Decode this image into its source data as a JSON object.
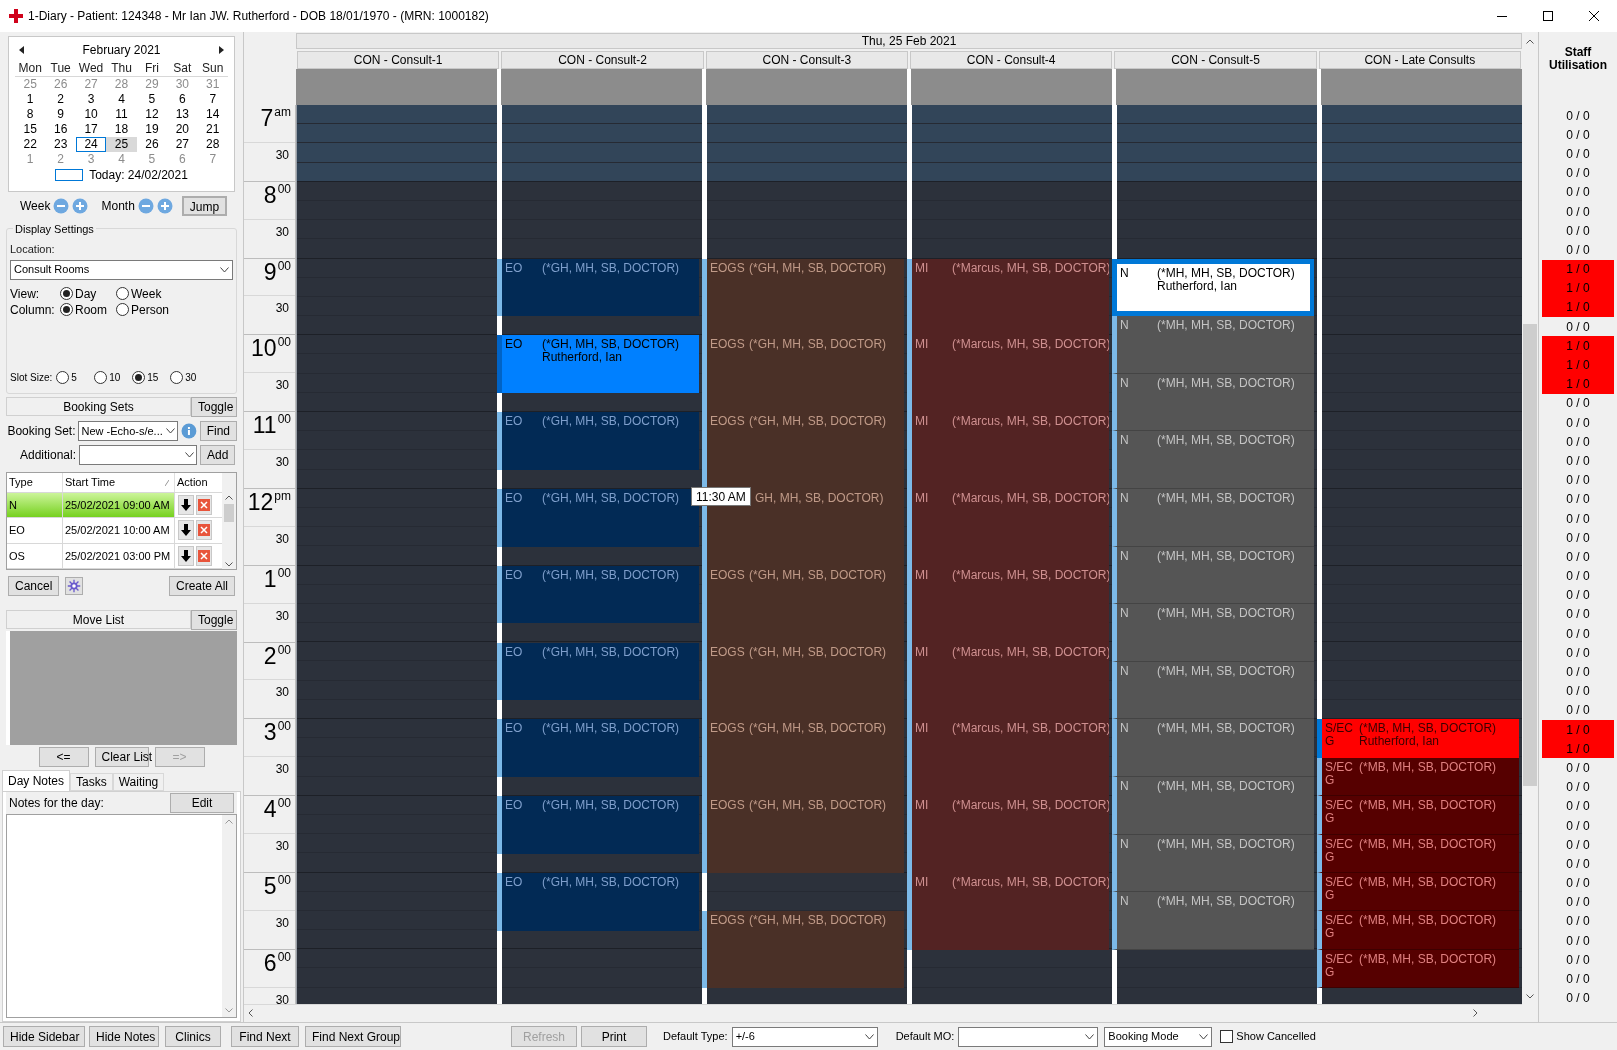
{
  "window": {
    "title": "1-Diary - Patient: 124348 - Mr Ian JW. Rutherford - DOB 18/01/1970 - (MRN: 1000182)"
  },
  "calendar": {
    "month": "February 2021",
    "weekdays": [
      "Mon",
      "Tue",
      "Wed",
      "Thu",
      "Fri",
      "Sat",
      "Sun"
    ],
    "weeks": [
      [
        {
          "d": "25",
          "muted": true,
          "today": false,
          "selected": false
        },
        {
          "d": "26",
          "muted": true,
          "today": false,
          "selected": false
        },
        {
          "d": "27",
          "muted": true,
          "today": false,
          "selected": false
        },
        {
          "d": "28",
          "muted": true,
          "today": false,
          "selected": false
        },
        {
          "d": "29",
          "muted": true,
          "today": false,
          "selected": false
        },
        {
          "d": "30",
          "muted": true,
          "today": false,
          "selected": false
        },
        {
          "d": "31",
          "muted": true,
          "today": false,
          "selected": false
        }
      ],
      [
        {
          "d": "1",
          "muted": false,
          "today": false,
          "selected": false
        },
        {
          "d": "2",
          "muted": false,
          "today": false,
          "selected": false
        },
        {
          "d": "3",
          "muted": false,
          "today": false,
          "selected": false
        },
        {
          "d": "4",
          "muted": false,
          "today": false,
          "selected": false
        },
        {
          "d": "5",
          "muted": false,
          "today": false,
          "selected": false
        },
        {
          "d": "6",
          "muted": false,
          "today": false,
          "selected": false
        },
        {
          "d": "7",
          "muted": false,
          "today": false,
          "selected": false
        }
      ],
      [
        {
          "d": "8",
          "muted": false,
          "today": false,
          "selected": false
        },
        {
          "d": "9",
          "muted": false,
          "today": false,
          "selected": false
        },
        {
          "d": "10",
          "muted": false,
          "today": false,
          "selected": false
        },
        {
          "d": "11",
          "muted": false,
          "today": false,
          "selected": false
        },
        {
          "d": "12",
          "muted": false,
          "today": false,
          "selected": false
        },
        {
          "d": "13",
          "muted": false,
          "today": false,
          "selected": false
        },
        {
          "d": "14",
          "muted": false,
          "today": false,
          "selected": false
        }
      ],
      [
        {
          "d": "15",
          "muted": false,
          "today": false,
          "selected": false
        },
        {
          "d": "16",
          "muted": false,
          "today": false,
          "selected": false
        },
        {
          "d": "17",
          "muted": false,
          "today": false,
          "selected": false
        },
        {
          "d": "18",
          "muted": false,
          "today": false,
          "selected": false
        },
        {
          "d": "19",
          "muted": false,
          "today": false,
          "selected": false
        },
        {
          "d": "20",
          "muted": false,
          "today": false,
          "selected": false
        },
        {
          "d": "21",
          "muted": false,
          "today": false,
          "selected": false
        }
      ],
      [
        {
          "d": "22",
          "muted": false,
          "today": false,
          "selected": false
        },
        {
          "d": "23",
          "muted": false,
          "today": false,
          "selected": false
        },
        {
          "d": "24",
          "muted": false,
          "today": true,
          "selected": false
        },
        {
          "d": "25",
          "muted": false,
          "today": false,
          "selected": true
        },
        {
          "d": "26",
          "muted": false,
          "today": false,
          "selected": false
        },
        {
          "d": "27",
          "muted": false,
          "today": false,
          "selected": false
        },
        {
          "d": "28",
          "muted": false,
          "today": false,
          "selected": false
        }
      ],
      [
        {
          "d": "1",
          "muted": true,
          "today": false,
          "selected": false
        },
        {
          "d": "2",
          "muted": true,
          "today": false,
          "selected": false
        },
        {
          "d": "3",
          "muted": true,
          "today": false,
          "selected": false
        },
        {
          "d": "4",
          "muted": true,
          "today": false,
          "selected": false
        },
        {
          "d": "5",
          "muted": true,
          "today": false,
          "selected": false
        },
        {
          "d": "6",
          "muted": true,
          "today": false,
          "selected": false
        },
        {
          "d": "7",
          "muted": true,
          "today": false,
          "selected": false
        }
      ]
    ],
    "today_label": "Today: 24/02/2021"
  },
  "nav": {
    "week": "Week",
    "month": "Month",
    "jump": "Jump"
  },
  "display_settings": {
    "title": "Display Settings",
    "location_label": "Location:",
    "location": "Consult Rooms",
    "view_label": "View:",
    "view_options": [
      {
        "label": "Day",
        "selected": true
      },
      {
        "label": "Week",
        "selected": false
      }
    ],
    "column_label": "Column:",
    "column_options": [
      {
        "label": "Room",
        "selected": true
      },
      {
        "label": "Person",
        "selected": false
      }
    ],
    "slot_label": "Slot Size:",
    "slot_options": [
      {
        "label": "5",
        "selected": false
      },
      {
        "label": "10",
        "selected": false
      },
      {
        "label": "15",
        "selected": true
      },
      {
        "label": "30",
        "selected": false
      }
    ]
  },
  "booking_sets": {
    "title": "Booking Sets",
    "toggle": "Toggle",
    "set_label": "Booking Set:",
    "set_value": "New -Echo-s/e...",
    "find": "Find",
    "additional_label": "Additional:",
    "add": "Add",
    "columns": [
      "Type",
      "Start Time",
      "Action"
    ],
    "rows": [
      {
        "type": "N",
        "start": "25/02/2021 09:00 AM",
        "selected": true
      },
      {
        "type": "EO",
        "start": "25/02/2021 10:00 AM",
        "selected": false
      },
      {
        "type": "OS",
        "start": "25/02/2021 03:00 PM",
        "selected": false
      }
    ],
    "cancel": "Cancel",
    "create_all": "Create All"
  },
  "move_list": {
    "title": "Move List",
    "toggle": "Toggle",
    "buttons": [
      {
        "label": "<=",
        "disabled": false
      },
      {
        "label": "Clear List",
        "disabled": false
      },
      {
        "label": "=>",
        "disabled": true
      }
    ]
  },
  "notes": {
    "tabs": [
      {
        "label": "Day Notes",
        "selected": true
      },
      {
        "label": "Tasks",
        "selected": false
      },
      {
        "label": "Waiting",
        "selected": false
      }
    ],
    "label": "Notes for the day:",
    "edit": "Edit"
  },
  "schedule": {
    "date": "Thu, 25 Feb 2021",
    "tooltip": "11:30 AM",
    "hours": [
      {
        "hour": "7",
        "suffix": "am",
        "half": "30"
      },
      {
        "hour": "8",
        "suffix": "00",
        "half": "30"
      },
      {
        "hour": "9",
        "suffix": "00",
        "half": "30"
      },
      {
        "hour": "10",
        "suffix": "00",
        "half": "30"
      },
      {
        "hour": "11",
        "suffix": "00",
        "half": "30"
      },
      {
        "hour": "12",
        "suffix": "pm",
        "half": "30"
      },
      {
        "hour": "1",
        "suffix": "00",
        "half": "30"
      },
      {
        "hour": "2",
        "suffix": "00",
        "half": "30"
      },
      {
        "hour": "3",
        "suffix": "00",
        "half": "30"
      },
      {
        "hour": "4",
        "suffix": "00",
        "half": "30"
      },
      {
        "hour": "5",
        "suffix": "00",
        "half": "30"
      },
      {
        "hour": "6",
        "suffix": "00",
        "half": "30"
      }
    ],
    "columns": [
      {
        "name": "CON - Consult-1",
        "kind": "eo"
      },
      {
        "name": "CON - Consult-2",
        "kind": "eo",
        "entries": [
          {
            "kind": "free_hour"
          },
          {
            "kind": "free_hour"
          },
          {
            "kind": "appointment",
            "code": "EO",
            "staff": "(*GH, MH, SB, DOCTOR)",
            "booked": false
          },
          {
            "kind": "free_quarter"
          },
          {
            "kind": "appointment",
            "code": "EO",
            "staff": "(*GH, MH, SB, DOCTOR)",
            "patient": "Rutherford, Ian",
            "booked": true
          },
          {
            "kind": "free_quarter"
          },
          {
            "kind": "appointment",
            "code": "EO",
            "staff": "(*GH, MH, SB, DOCTOR)",
            "booked": false
          },
          {
            "kind": "free_quarter"
          },
          {
            "kind": "appointment",
            "code": "EO",
            "staff": "(*GH, MH, SB, DOCTOR)",
            "booked": false
          },
          {
            "kind": "free_quarter"
          },
          {
            "kind": "appointment",
            "code": "EO",
            "staff": "(*GH, MH, SB, DOCTOR)",
            "booked": false
          },
          {
            "kind": "free_quarter"
          },
          {
            "kind": "appointment",
            "code": "EO",
            "staff": "(*GH, MH, SB, DOCTOR)",
            "booked": false
          },
          {
            "kind": "free_quarter"
          },
          {
            "kind": "appointment",
            "code": "EO",
            "staff": "(*GH, MH, SB, DOCTOR)",
            "booked": false
          },
          {
            "kind": "free_quarter"
          },
          {
            "kind": "appointment",
            "code": "EO",
            "staff": "(*GH, MH, SB, DOCTOR)",
            "booked": false
          },
          {
            "kind": "free_quarter"
          },
          {
            "kind": "appointment",
            "code": "EO",
            "staff": "(*GH, MH, SB, DOCTOR)",
            "booked": false
          }
        ]
      },
      {
        "name": "CON - Consult-3",
        "kind": "eogs",
        "entries": [
          {
            "kind": "free_hour"
          },
          {
            "kind": "free_hour"
          },
          {
            "kind": "appointment",
            "code": "EOGS",
            "staff": "(*GH, MH, SB, DOCTOR)",
            "booked": false
          },
          {
            "kind": "appointment",
            "code": "EOGS",
            "staff": "(*GH, MH, SB, DOCTOR)",
            "booked": false
          },
          {
            "kind": "appointment",
            "code": "EOGS",
            "staff": "(*GH, MH, SB, DOCTOR)",
            "booked": false
          },
          {
            "kind": "appointment",
            "staff": "GH, MH, SB, DOCTOR)",
            "booked": false
          },
          {
            "kind": "appointment",
            "code": "EOGS",
            "staff": "(*GH, MH, SB, DOCTOR)",
            "booked": false
          },
          {
            "kind": "appointment",
            "code": "EOGS",
            "staff": "(*GH, MH, SB, DOCTOR)",
            "booked": false
          },
          {
            "kind": "appointment",
            "code": "EOGS",
            "staff": "(*GH, MH, SB, DOCTOR)",
            "booked": false
          },
          {
            "kind": "appointment",
            "code": "EOGS",
            "staff": "(*GH, MH, SB, DOCTOR)",
            "booked": false
          },
          {
            "kind": "free_quarter"
          },
          {
            "kind": "free_quarter"
          },
          {
            "kind": "appointment",
            "code": "EOGS",
            "staff": "(*GH, MH, SB, DOCTOR)",
            "booked": false
          }
        ]
      },
      {
        "name": "CON - Consult-4",
        "kind": "mi",
        "entries": [
          {
            "kind": "free_hour"
          },
          {
            "kind": "free_hour"
          },
          {
            "kind": "appointment",
            "code": "MI",
            "staff": "(*Marcus, MH, SB, DOCTOR)",
            "booked": false
          },
          {
            "kind": "appointment",
            "code": "MI",
            "staff": "(*Marcus, MH, SB, DOCTOR)",
            "booked": false
          },
          {
            "kind": "appointment",
            "code": "MI",
            "staff": "(*Marcus, MH, SB, DOCTOR)",
            "booked": false
          },
          {
            "kind": "appointment",
            "code": "MI",
            "staff": "(*Marcus, MH, SB, DOCTOR)",
            "booked": false
          },
          {
            "kind": "appointment",
            "code": "MI",
            "staff": "(*Marcus, MH, SB, DOCTOR)",
            "booked": false
          },
          {
            "kind": "appointment",
            "code": "MI",
            "staff": "(*Marcus, MH, SB, DOCTOR)",
            "booked": false
          },
          {
            "kind": "appointment",
            "code": "MI",
            "staff": "(*Marcus, MH, SB, DOCTOR)",
            "booked": false
          },
          {
            "kind": "appointment",
            "code": "MI",
            "staff": "(*Marcus, MH, SB, DOCTOR)",
            "booked": false
          },
          {
            "kind": "appointment",
            "code": "MI",
            "staff": "(*Marcus, MH, SB, DOCTOR)",
            "booked": false
          }
        ]
      },
      {
        "name": "CON - Consult-5",
        "kind": "n",
        "entries": [
          {
            "kind": "free_hour"
          },
          {
            "kind": "free_hour"
          },
          {
            "kind": "appointment",
            "code": "N",
            "staff": "(*MH, MH, SB, DOCTOR)",
            "patient": "Rutherford, Ian",
            "booked": true
          },
          {
            "kind": "appointment",
            "code": "N",
            "staff": "(*MH, MH, SB, DOCTOR)",
            "booked": false
          },
          {
            "kind": "appointment",
            "code": "N",
            "staff": "(*MH, MH, SB, DOCTOR)",
            "booked": false
          },
          {
            "kind": "appointment",
            "code": "N",
            "staff": "(*MH, MH, SB, DOCTOR)",
            "booked": false
          },
          {
            "kind": "appointment",
            "code": "N",
            "staff": "(*MH, MH, SB, DOCTOR)",
            "booked": false
          },
          {
            "kind": "appointment",
            "code": "N",
            "staff": "(*MH, MH, SB, DOCTOR)",
            "booked": false
          },
          {
            "kind": "appointment",
            "code": "N",
            "staff": "(*MH, MH, SB, DOCTOR)",
            "booked": false
          },
          {
            "kind": "appointment",
            "code": "N",
            "staff": "(*MH, MH, SB, DOCTOR)",
            "booked": false
          },
          {
            "kind": "appointment",
            "code": "N",
            "staff": "(*MH, MH, SB, DOCTOR)",
            "booked": false
          },
          {
            "kind": "appointment",
            "code": "N",
            "staff": "(*MH, MH, SB, DOCTOR)",
            "booked": false
          },
          {
            "kind": "appointment",
            "code": "N",
            "staff": "(*MH, MH, SB, DOCTOR)",
            "booked": false
          },
          {
            "kind": "appointment",
            "code": "N",
            "staff": "(*MH, MH, SB, DOCTOR)",
            "booked": false
          }
        ]
      },
      {
        "name": "CON - Late Consults",
        "kind": "secg",
        "entries": [
          {
            "kind": "free_hour"
          },
          {
            "kind": "free_hour"
          },
          {
            "kind": "free_hour"
          },
          {
            "kind": "free_hour"
          },
          {
            "kind": "free_hour"
          },
          {
            "kind": "free_hour"
          },
          {
            "kind": "free_hour"
          },
          {
            "kind": "free_hour"
          },
          {
            "kind": "appointment",
            "code": "S/ECG",
            "staff": "(*MB, MH, SB, DOCTOR)",
            "patient": "Rutherford, Ian",
            "booked": true
          },
          {
            "kind": "appointment",
            "code": "S/ECG",
            "staff": "(*MB, MH, SB, DOCTOR)",
            "booked": false
          },
          {
            "kind": "appointment",
            "code": "S/ECG",
            "staff": "(*MB, MH, SB, DOCTOR)",
            "booked": false
          },
          {
            "kind": "appointment",
            "code": "S/ECG",
            "staff": "(*MB, MH, SB, DOCTOR)",
            "booked": false
          },
          {
            "kind": "appointment",
            "code": "S/ECG",
            "staff": "(*MB, MH, SB, DOCTOR)",
            "booked": false
          },
          {
            "kind": "appointment",
            "code": "S/ECG",
            "staff": "(*MB, MH, SB, DOCTOR)",
            "booked": false
          },
          {
            "kind": "appointment",
            "code": "S/ECG",
            "staff": "(*MB, MH, SB, DOCTOR)",
            "booked": false
          }
        ]
      }
    ]
  },
  "utilisation": {
    "title": "Staff Utilisation",
    "rows": [
      {
        "value": "0 / 0",
        "over": false
      },
      {
        "value": "0 / 0",
        "over": false
      },
      {
        "value": "0 / 0",
        "over": false
      },
      {
        "value": "0 / 0",
        "over": false
      },
      {
        "value": "0 / 0",
        "over": false
      },
      {
        "value": "0 / 0",
        "over": false
      },
      {
        "value": "0 / 0",
        "over": false
      },
      {
        "value": "0 / 0",
        "over": false
      },
      {
        "value": "1 / 0",
        "over": true
      },
      {
        "value": "1 / 0",
        "over": true
      },
      {
        "value": "1 / 0",
        "over": true
      },
      {
        "value": "0 / 0",
        "over": false
      },
      {
        "value": "1 / 0",
        "over": true
      },
      {
        "value": "1 / 0",
        "over": true
      },
      {
        "value": "1 / 0",
        "over": true
      },
      {
        "value": "0 / 0",
        "over": false
      },
      {
        "value": "0 / 0",
        "over": false
      },
      {
        "value": "0 / 0",
        "over": false
      },
      {
        "value": "0 / 0",
        "over": false
      },
      {
        "value": "0 / 0",
        "over": false
      },
      {
        "value": "0 / 0",
        "over": false
      },
      {
        "value": "0 / 0",
        "over": false
      },
      {
        "value": "0 / 0",
        "over": false
      },
      {
        "value": "0 / 0",
        "over": false
      },
      {
        "value": "0 / 0",
        "over": false
      },
      {
        "value": "0 / 0",
        "over": false
      },
      {
        "value": "0 / 0",
        "over": false
      },
      {
        "value": "0 / 0",
        "over": false
      },
      {
        "value": "0 / 0",
        "over": false
      },
      {
        "value": "0 / 0",
        "over": false
      },
      {
        "value": "0 / 0",
        "over": false
      },
      {
        "value": "0 / 0",
        "over": false
      },
      {
        "value": "1 / 0",
        "over": true
      },
      {
        "value": "1 / 0",
        "over": true
      },
      {
        "value": "0 / 0",
        "over": false
      },
      {
        "value": "0 / 0",
        "over": false
      },
      {
        "value": "0 / 0",
        "over": false
      },
      {
        "value": "0 / 0",
        "over": false
      },
      {
        "value": "0 / 0",
        "over": false
      },
      {
        "value": "0 / 0",
        "over": false
      },
      {
        "value": "0 / 0",
        "over": false
      },
      {
        "value": "0 / 0",
        "over": false
      },
      {
        "value": "0 / 0",
        "over": false
      },
      {
        "value": "0 / 0",
        "over": false
      },
      {
        "value": "0 / 0",
        "over": false
      },
      {
        "value": "0 / 0",
        "over": false
      },
      {
        "value": "0 / 0",
        "over": false
      }
    ]
  },
  "toolbar": {
    "buttons": [
      {
        "label": "Hide Sidebar",
        "disabled": false
      },
      {
        "label": "Hide Notes",
        "disabled": false
      },
      {
        "label": "Clinics",
        "disabled": false
      },
      {
        "label": "Find Next",
        "disabled": false
      },
      {
        "label": "Find Next Group",
        "disabled": false
      },
      {
        "label": "Refresh",
        "disabled": true
      },
      {
        "label": "Print",
        "disabled": false
      }
    ],
    "default_type_label": "Default Type:",
    "default_type": "+/-6",
    "default_mo_label": "Default MO:",
    "mode": "Booking Mode",
    "show_cancelled": {
      "label": "Show Cancelled",
      "checked": false
    }
  }
}
